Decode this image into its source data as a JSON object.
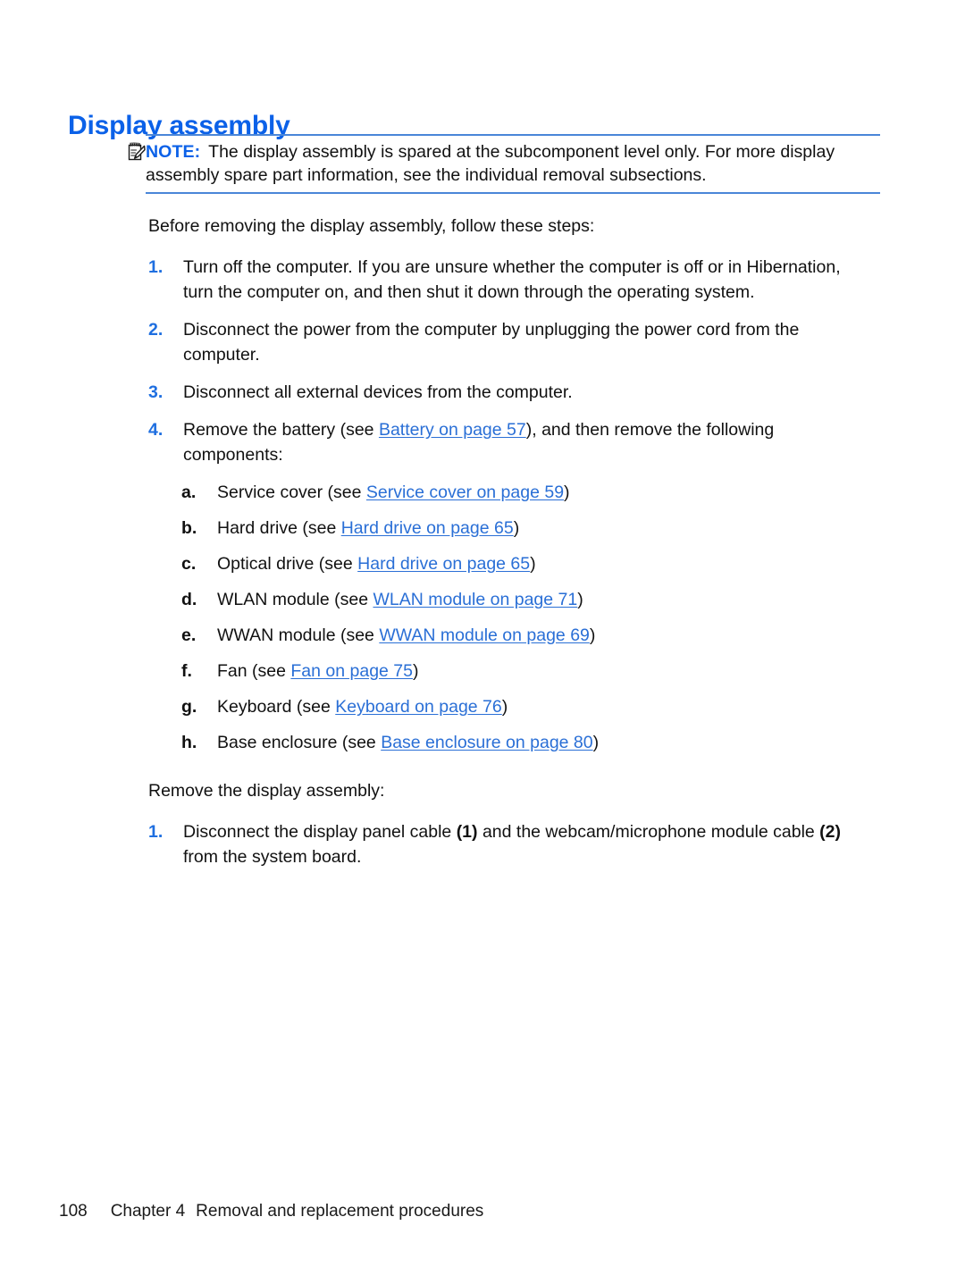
{
  "document": {
    "heading": "Display assembly"
  },
  "note": {
    "icon": "note-pad-pencil-icon",
    "label": "NOTE:",
    "text": "The display assembly is spared at the subcomponent level only. For more display assembly spare part information, see the individual removal subsections."
  },
  "intro": {
    "before_text": "Before removing the display assembly, follow these steps:",
    "remove_text": "Remove the display assembly:"
  },
  "steps": [
    {
      "marker": "1.",
      "text": "Turn off the computer. If you are unsure whether the computer is off or in Hibernation, turn the computer on, and then shut it down through the operating system."
    },
    {
      "marker": "2.",
      "text": "Disconnect the power from the computer by unplugging the power cord from the computer."
    },
    {
      "marker": "3.",
      "text": "Disconnect all external devices from the computer."
    },
    {
      "marker": "4.",
      "prefix": "Remove the battery (see ",
      "link": "Battery on page 57",
      "suffix": "), and then remove the following components:"
    }
  ],
  "components": [
    {
      "marker": "a.",
      "prefix": "Service cover (see ",
      "link": "Service cover on page 59",
      "suffix": ")"
    },
    {
      "marker": "b.",
      "prefix": "Hard drive (see ",
      "link": "Hard drive on page 65",
      "suffix": ")"
    },
    {
      "marker": "c.",
      "prefix": "Optical drive (see ",
      "link": "Hard drive on page 65",
      "suffix": ")"
    },
    {
      "marker": "d.",
      "prefix": "WLAN module (see ",
      "link": "WLAN module on page 71",
      "suffix": ")"
    },
    {
      "marker": "e.",
      "prefix": "WWAN module (see ",
      "link": "WWAN module on page 69",
      "suffix": ")"
    },
    {
      "marker": "f.",
      "prefix": "Fan (see ",
      "link": "Fan on page 75",
      "suffix": ")"
    },
    {
      "marker": "g.",
      "prefix": "Keyboard (see ",
      "link": "Keyboard on page 76",
      "suffix": ")"
    },
    {
      "marker": "h.",
      "prefix": "Base enclosure (see ",
      "link": "Base enclosure on page 80",
      "suffix": ")"
    }
  ],
  "final_step": {
    "marker": "1.",
    "part1": "Disconnect the display panel cable ",
    "cue1": "(1)",
    "part2": " and the webcam/microphone module cable ",
    "cue2": "(2)",
    "part3": " from the system board."
  },
  "footer": {
    "page_number": "108",
    "chapter": "Chapter 4",
    "chapter_title": "Removal and replacement procedures"
  },
  "colors": {
    "heading": "#0b61e8",
    "link": "#2a6fd6",
    "rule": "#4a86d8",
    "number_marker": "#1f6fe0",
    "body_text": "#111111"
  }
}
